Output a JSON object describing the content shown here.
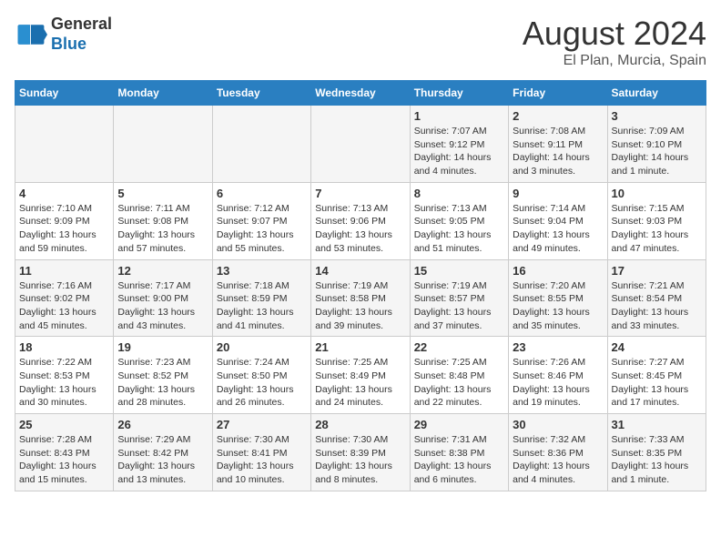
{
  "header": {
    "logo_general": "General",
    "logo_blue": "Blue",
    "month_year": "August 2024",
    "location": "El Plan, Murcia, Spain"
  },
  "calendar": {
    "days_of_week": [
      "Sunday",
      "Monday",
      "Tuesday",
      "Wednesday",
      "Thursday",
      "Friday",
      "Saturday"
    ],
    "weeks": [
      [
        {
          "day": "",
          "info": ""
        },
        {
          "day": "",
          "info": ""
        },
        {
          "day": "",
          "info": ""
        },
        {
          "day": "",
          "info": ""
        },
        {
          "day": "1",
          "info": "Sunrise: 7:07 AM\nSunset: 9:12 PM\nDaylight: 14 hours\nand 4 minutes."
        },
        {
          "day": "2",
          "info": "Sunrise: 7:08 AM\nSunset: 9:11 PM\nDaylight: 14 hours\nand 3 minutes."
        },
        {
          "day": "3",
          "info": "Sunrise: 7:09 AM\nSunset: 9:10 PM\nDaylight: 14 hours\nand 1 minute."
        }
      ],
      [
        {
          "day": "4",
          "info": "Sunrise: 7:10 AM\nSunset: 9:09 PM\nDaylight: 13 hours\nand 59 minutes."
        },
        {
          "day": "5",
          "info": "Sunrise: 7:11 AM\nSunset: 9:08 PM\nDaylight: 13 hours\nand 57 minutes."
        },
        {
          "day": "6",
          "info": "Sunrise: 7:12 AM\nSunset: 9:07 PM\nDaylight: 13 hours\nand 55 minutes."
        },
        {
          "day": "7",
          "info": "Sunrise: 7:13 AM\nSunset: 9:06 PM\nDaylight: 13 hours\nand 53 minutes."
        },
        {
          "day": "8",
          "info": "Sunrise: 7:13 AM\nSunset: 9:05 PM\nDaylight: 13 hours\nand 51 minutes."
        },
        {
          "day": "9",
          "info": "Sunrise: 7:14 AM\nSunset: 9:04 PM\nDaylight: 13 hours\nand 49 minutes."
        },
        {
          "day": "10",
          "info": "Sunrise: 7:15 AM\nSunset: 9:03 PM\nDaylight: 13 hours\nand 47 minutes."
        }
      ],
      [
        {
          "day": "11",
          "info": "Sunrise: 7:16 AM\nSunset: 9:02 PM\nDaylight: 13 hours\nand 45 minutes."
        },
        {
          "day": "12",
          "info": "Sunrise: 7:17 AM\nSunset: 9:00 PM\nDaylight: 13 hours\nand 43 minutes."
        },
        {
          "day": "13",
          "info": "Sunrise: 7:18 AM\nSunset: 8:59 PM\nDaylight: 13 hours\nand 41 minutes."
        },
        {
          "day": "14",
          "info": "Sunrise: 7:19 AM\nSunset: 8:58 PM\nDaylight: 13 hours\nand 39 minutes."
        },
        {
          "day": "15",
          "info": "Sunrise: 7:19 AM\nSunset: 8:57 PM\nDaylight: 13 hours\nand 37 minutes."
        },
        {
          "day": "16",
          "info": "Sunrise: 7:20 AM\nSunset: 8:55 PM\nDaylight: 13 hours\nand 35 minutes."
        },
        {
          "day": "17",
          "info": "Sunrise: 7:21 AM\nSunset: 8:54 PM\nDaylight: 13 hours\nand 33 minutes."
        }
      ],
      [
        {
          "day": "18",
          "info": "Sunrise: 7:22 AM\nSunset: 8:53 PM\nDaylight: 13 hours\nand 30 minutes."
        },
        {
          "day": "19",
          "info": "Sunrise: 7:23 AM\nSunset: 8:52 PM\nDaylight: 13 hours\nand 28 minutes."
        },
        {
          "day": "20",
          "info": "Sunrise: 7:24 AM\nSunset: 8:50 PM\nDaylight: 13 hours\nand 26 minutes."
        },
        {
          "day": "21",
          "info": "Sunrise: 7:25 AM\nSunset: 8:49 PM\nDaylight: 13 hours\nand 24 minutes."
        },
        {
          "day": "22",
          "info": "Sunrise: 7:25 AM\nSunset: 8:48 PM\nDaylight: 13 hours\nand 22 minutes."
        },
        {
          "day": "23",
          "info": "Sunrise: 7:26 AM\nSunset: 8:46 PM\nDaylight: 13 hours\nand 19 minutes."
        },
        {
          "day": "24",
          "info": "Sunrise: 7:27 AM\nSunset: 8:45 PM\nDaylight: 13 hours\nand 17 minutes."
        }
      ],
      [
        {
          "day": "25",
          "info": "Sunrise: 7:28 AM\nSunset: 8:43 PM\nDaylight: 13 hours\nand 15 minutes."
        },
        {
          "day": "26",
          "info": "Sunrise: 7:29 AM\nSunset: 8:42 PM\nDaylight: 13 hours\nand 13 minutes."
        },
        {
          "day": "27",
          "info": "Sunrise: 7:30 AM\nSunset: 8:41 PM\nDaylight: 13 hours\nand 10 minutes."
        },
        {
          "day": "28",
          "info": "Sunrise: 7:30 AM\nSunset: 8:39 PM\nDaylight: 13 hours\nand 8 minutes."
        },
        {
          "day": "29",
          "info": "Sunrise: 7:31 AM\nSunset: 8:38 PM\nDaylight: 13 hours\nand 6 minutes."
        },
        {
          "day": "30",
          "info": "Sunrise: 7:32 AM\nSunset: 8:36 PM\nDaylight: 13 hours\nand 4 minutes."
        },
        {
          "day": "31",
          "info": "Sunrise: 7:33 AM\nSunset: 8:35 PM\nDaylight: 13 hours\nand 1 minute."
        }
      ]
    ]
  }
}
